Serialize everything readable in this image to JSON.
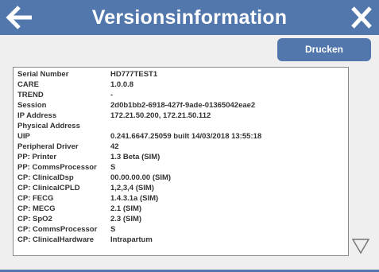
{
  "window": {
    "title": "Versionsinformation",
    "back_icon": "arrow-left-icon",
    "close_icon": "close-icon"
  },
  "toolbar": {
    "print_label": "Drucken"
  },
  "info": {
    "rows": [
      {
        "label": "Serial Number",
        "value": "HD777TEST1"
      },
      {
        "label": "CARE",
        "value": "1.0.0.8"
      },
      {
        "label": "TREND",
        "value": "-"
      },
      {
        "label": "Session",
        "value": "2d0b1bb2-6918-427f-9ade-01365042eae2"
      },
      {
        "label": "IP Address",
        "value": "172.21.50.200, 172.21.50.112"
      },
      {
        "label": "Physical Address",
        "value": ""
      },
      {
        "label": "UIP",
        "value": "0.241.6647.25059 built 14/03/2018 13:55:18"
      },
      {
        "label": "Peripheral Driver",
        "value": "42"
      },
      {
        "label": "PP: Printer",
        "value": "1.3 Beta (SIM)"
      },
      {
        "label": "PP: CommsProcessor",
        "value": "S"
      },
      {
        "label": "CP: ClinicalDsp",
        "value": "00.00.00.00 (SIM)"
      },
      {
        "label": "CP: ClinicalCPLD",
        "value": "1,2,3,4 (SIM)"
      },
      {
        "label": "CP: FECG",
        "value": "1.4.3.1a (SIM)"
      },
      {
        "label": "CP: MECG",
        "value": "2.1 (SIM)"
      },
      {
        "label": "CP: SpO2",
        "value": "2.3 (SIM)"
      },
      {
        "label": "CP: CommsProcessor",
        "value": "S"
      },
      {
        "label": "CP: ClinicalHardware",
        "value": "Intrapartum"
      }
    ]
  },
  "scroll": {
    "down_icon": "triangle-down-icon"
  },
  "colors": {
    "accent": "#5277ad",
    "background": "#efefef",
    "panel": "#ffffff"
  }
}
